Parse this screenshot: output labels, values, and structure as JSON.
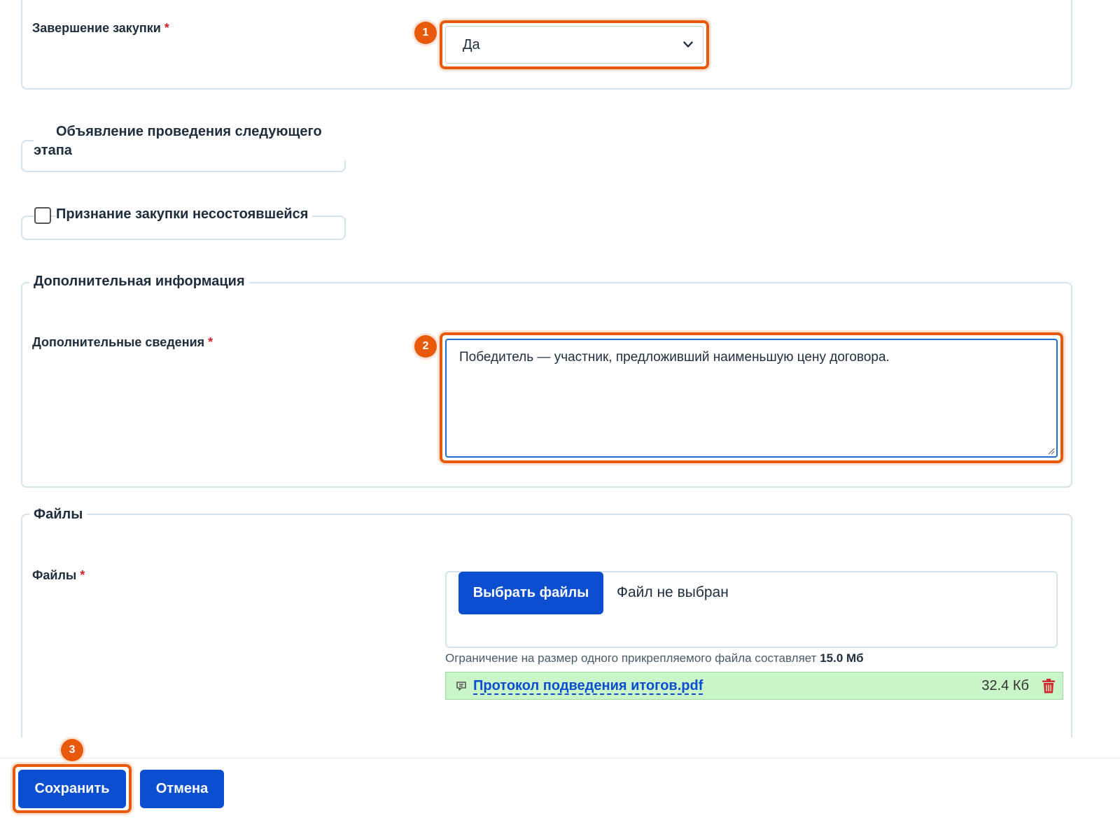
{
  "completion": {
    "label": "Завершение закупки",
    "required_mark": "*",
    "value": "Да",
    "badge": "1"
  },
  "checkboxes": {
    "next_stage": {
      "label": "Объявление проведения следующего этапа",
      "checked": false
    },
    "failed": {
      "label": "Признание закупки несостоявшейся",
      "checked": false
    }
  },
  "additional": {
    "legend": "Дополнительная информация",
    "label": "Дополнительные сведения",
    "required_mark": "*",
    "value": "Победитель — участник, предложивший наименьшую цену договора.",
    "badge": "2"
  },
  "files": {
    "legend": "Файлы",
    "label": "Файлы",
    "required_mark": "*",
    "choose_button": "Выбрать файлы",
    "no_file_text": "Файл не выбран",
    "limit_text": "Ограничение на размер одного прикрепляемого файла составляет",
    "limit_value": "15.0 Мб",
    "attached": {
      "name": "Протокол подведения итогов.pdf",
      "size": "32.4 Кб"
    }
  },
  "footer": {
    "save_button": "Сохранить",
    "cancel_button": "Отмена",
    "badge": "3"
  },
  "colors": {
    "accent": "#e8590c",
    "primary": "#0b4ed0",
    "file_bg": "#c9f5c9",
    "required": "#d0262d",
    "delete": "#d0262d"
  }
}
